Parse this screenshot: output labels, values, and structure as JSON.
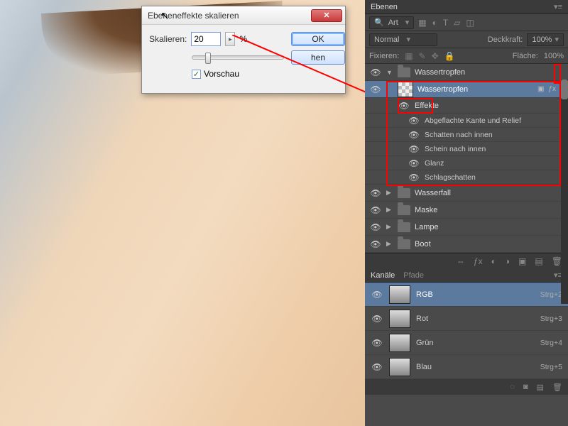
{
  "dialog": {
    "title": "Ebeneneffekte skalieren",
    "scale_label": "Skalieren:",
    "scale_value": "20",
    "percent": "%",
    "ok": "OK",
    "cancel_suffix": "hen",
    "preview": "Vorschau"
  },
  "panel": {
    "layers_tab": "Ebenen",
    "filter_kind": "Art",
    "blend_mode": "Normal",
    "opacity_label": "Deckkraft:",
    "opacity_value": "100%",
    "lock_label": "Fixieren:",
    "fill_label": "Fläche:",
    "fill_value": "100%"
  },
  "groups": {
    "g0": "Wassertropfen",
    "layer_sel": "Wassertropfen",
    "fx_label": "Effekte",
    "fx": {
      "a": "Abgeflachte Kante und Relief",
      "b": "Schatten nach innen",
      "c": "Schein nach innen",
      "d": "Glanz",
      "e": "Schlagschatten"
    },
    "g1": "Wasserfall",
    "g2": "Maske",
    "g3": "Lampe",
    "g4": "Boot"
  },
  "channels": {
    "tab1": "Kanäle",
    "tab2": "Pfade",
    "rgb": "RGB",
    "rgb_sc": "Strg+2",
    "r": "Rot",
    "r_sc": "Strg+3",
    "g": "Grün",
    "g_sc": "Strg+4",
    "b": "Blau",
    "b_sc": "Strg+5"
  },
  "fxglyph": "ƒx"
}
